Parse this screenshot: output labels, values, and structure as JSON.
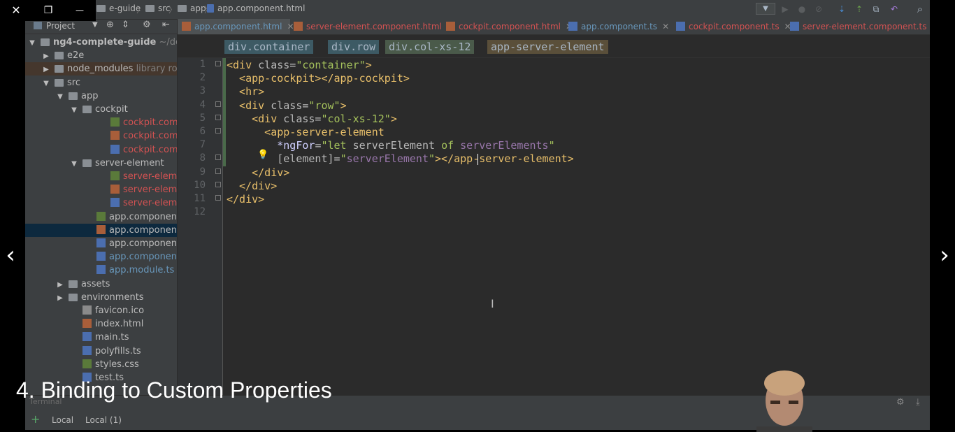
{
  "window_controls": {
    "close": "✕",
    "restore": "❐",
    "minimize": "—"
  },
  "breadcrumb": {
    "project": "e-guide",
    "src": "src",
    "app": "app",
    "file": "app.component.html"
  },
  "project_panel": {
    "title": "Project"
  },
  "tree": [
    {
      "label": "ng4-complete-guide",
      "suffix": "~/dev",
      "arrow": "▼",
      "icon": "folder",
      "indent": 0,
      "bold": true,
      "color": "#bbbbbb"
    },
    {
      "label": "e2e",
      "arrow": "▶",
      "icon": "folder",
      "indent": 1,
      "color": "#bbbbbb"
    },
    {
      "label": "node_modules",
      "suffix": "library roo",
      "arrow": "▶",
      "icon": "folder",
      "indent": 1,
      "color": "#bbbbbb",
      "highlight": "#45372d"
    },
    {
      "label": "src",
      "arrow": "▼",
      "icon": "folder",
      "indent": 1,
      "color": "#bbbbbb"
    },
    {
      "label": "app",
      "arrow": "▼",
      "icon": "folder",
      "indent": 2,
      "color": "#bbbbbb"
    },
    {
      "label": "cockpit",
      "arrow": "▼",
      "icon": "folder",
      "indent": 3,
      "color": "#bbbbbb"
    },
    {
      "label": "cockpit.compon",
      "icon": "css",
      "indent": 5,
      "color": "#d25252"
    },
    {
      "label": "cockpit.compo",
      "icon": "html",
      "indent": 5,
      "color": "#d25252"
    },
    {
      "label": "cockpit.compo",
      "icon": "ts",
      "indent": 5,
      "color": "#d25252"
    },
    {
      "label": "server-element",
      "arrow": "▼",
      "icon": "folder",
      "indent": 3,
      "color": "#bbbbbb"
    },
    {
      "label": "server-element.",
      "icon": "css",
      "indent": 5,
      "color": "#d25252"
    },
    {
      "label": "server-element.",
      "icon": "html",
      "indent": 5,
      "color": "#d25252"
    },
    {
      "label": "server-element.",
      "icon": "ts",
      "indent": 5,
      "color": "#d25252"
    },
    {
      "label": "app.component.cs",
      "icon": "css",
      "indent": 4,
      "color": "#bbbbbb"
    },
    {
      "label": "app.component.ht",
      "icon": "html",
      "indent": 4,
      "color": "#bbbbbb",
      "selected": true
    },
    {
      "label": "app.component.sp",
      "icon": "ts",
      "indent": 4,
      "color": "#bbbbbb"
    },
    {
      "label": "app.component.ts",
      "icon": "ts",
      "indent": 4,
      "color": "#6897bb"
    },
    {
      "label": "app.module.ts",
      "icon": "ts",
      "indent": 4,
      "color": "#6897bb"
    },
    {
      "label": "assets",
      "arrow": "▶",
      "icon": "folder",
      "indent": 2,
      "color": "#bbbbbb"
    },
    {
      "label": "environments",
      "arrow": "▶",
      "icon": "folder",
      "indent": 2,
      "color": "#bbbbbb"
    },
    {
      "label": "favicon.ico",
      "icon": "ico",
      "indent": 3,
      "color": "#bbbbbb"
    },
    {
      "label": "index.html",
      "icon": "html",
      "indent": 3,
      "color": "#bbbbbb"
    },
    {
      "label": "main.ts",
      "icon": "ts",
      "indent": 3,
      "color": "#bbbbbb"
    },
    {
      "label": "polyfills.ts",
      "icon": "ts",
      "indent": 3,
      "color": "#bbbbbb"
    },
    {
      "label": "styles.css",
      "icon": "css",
      "indent": 3,
      "color": "#bbbbbb"
    },
    {
      "label": "test.ts",
      "icon": "ts",
      "indent": 3,
      "color": "#bbbbbb"
    }
  ],
  "tabs": [
    {
      "label": "app.component.html",
      "icon": "html",
      "color": "#6897bb",
      "active": true
    },
    {
      "label": "server-element.component.html",
      "icon": "html",
      "color": "#d25252"
    },
    {
      "label": "cockpit.component.html",
      "icon": "html",
      "color": "#d25252"
    },
    {
      "label": "app.component.ts",
      "icon": "ts",
      "color": "#6897bb"
    },
    {
      "label": "cockpit.component.ts",
      "icon": "ts",
      "color": "#d25252"
    },
    {
      "label": "server-element.component.ts",
      "icon": "ts",
      "color": "#d25252"
    }
  ],
  "tag_breadcrumb": [
    {
      "label": "div.container",
      "bg": "#3d5a64"
    },
    {
      "label": "div.row",
      "bg": "#3d5a64"
    },
    {
      "label": "div.col-xs-12",
      "bg": "#4a5a4a"
    },
    {
      "label": "app-server-element",
      "bg": "#5a4f3a"
    }
  ],
  "line_numbers": [
    "1",
    "2",
    "3",
    "4",
    "5",
    "6",
    "7",
    "8",
    "9",
    "10",
    "11",
    "12"
  ],
  "code_lines": [
    [
      {
        "t": "<div ",
        "c": "tg"
      },
      {
        "t": "class=",
        "c": "at"
      },
      {
        "t": "\"container\"",
        "c": "sv"
      },
      {
        "t": ">",
        "c": "tg"
      }
    ],
    [
      {
        "t": "  <app-cockpit></app-cockpit>",
        "c": "tg"
      }
    ],
    [
      {
        "t": "  <hr>",
        "c": "tg"
      }
    ],
    [
      {
        "t": "  <div ",
        "c": "tg"
      },
      {
        "t": "class=",
        "c": "at"
      },
      {
        "t": "\"row\"",
        "c": "sv"
      },
      {
        "t": ">",
        "c": "tg"
      }
    ],
    [
      {
        "t": "    <div ",
        "c": "tg"
      },
      {
        "t": "class=",
        "c": "at"
      },
      {
        "t": "\"col-xs-12\"",
        "c": "sv"
      },
      {
        "t": ">",
        "c": "tg"
      }
    ],
    [
      {
        "t": "      <app-server-element",
        "c": "tg"
      }
    ],
    [
      {
        "t": "        ",
        "c": "at"
      },
      {
        "t": "*ngFor",
        "c": "ngf"
      },
      {
        "t": "=",
        "c": "at"
      },
      {
        "t": "\"let ",
        "c": "sv"
      },
      {
        "t": "serverElement ",
        "c": "at"
      },
      {
        "t": "of ",
        "c": "sv"
      },
      {
        "t": "serverElements",
        "c": "it"
      },
      {
        "t": "\"",
        "c": "sv"
      }
    ],
    [
      {
        "t": "        [element]=",
        "c": "at"
      },
      {
        "t": "\"",
        "c": "sv"
      },
      {
        "t": "serverElement",
        "c": "it"
      },
      {
        "t": "\"",
        "c": "sv"
      },
      {
        "t": "></app-server-element>",
        "c": "tg"
      }
    ],
    [
      {
        "t": "    </div>",
        "c": "tg"
      }
    ],
    [
      {
        "t": "  </div>",
        "c": "tg"
      }
    ],
    [
      {
        "t": "</div>",
        "c": "tg"
      }
    ],
    [
      {
        "t": "",
        "c": "at"
      }
    ]
  ],
  "terminal": {
    "title": "Terminal",
    "tabs": [
      "Local",
      "Local (1)"
    ]
  },
  "caption": "4. Binding to Custom Properties",
  "nav": {
    "prev": "‹",
    "next": "›"
  }
}
